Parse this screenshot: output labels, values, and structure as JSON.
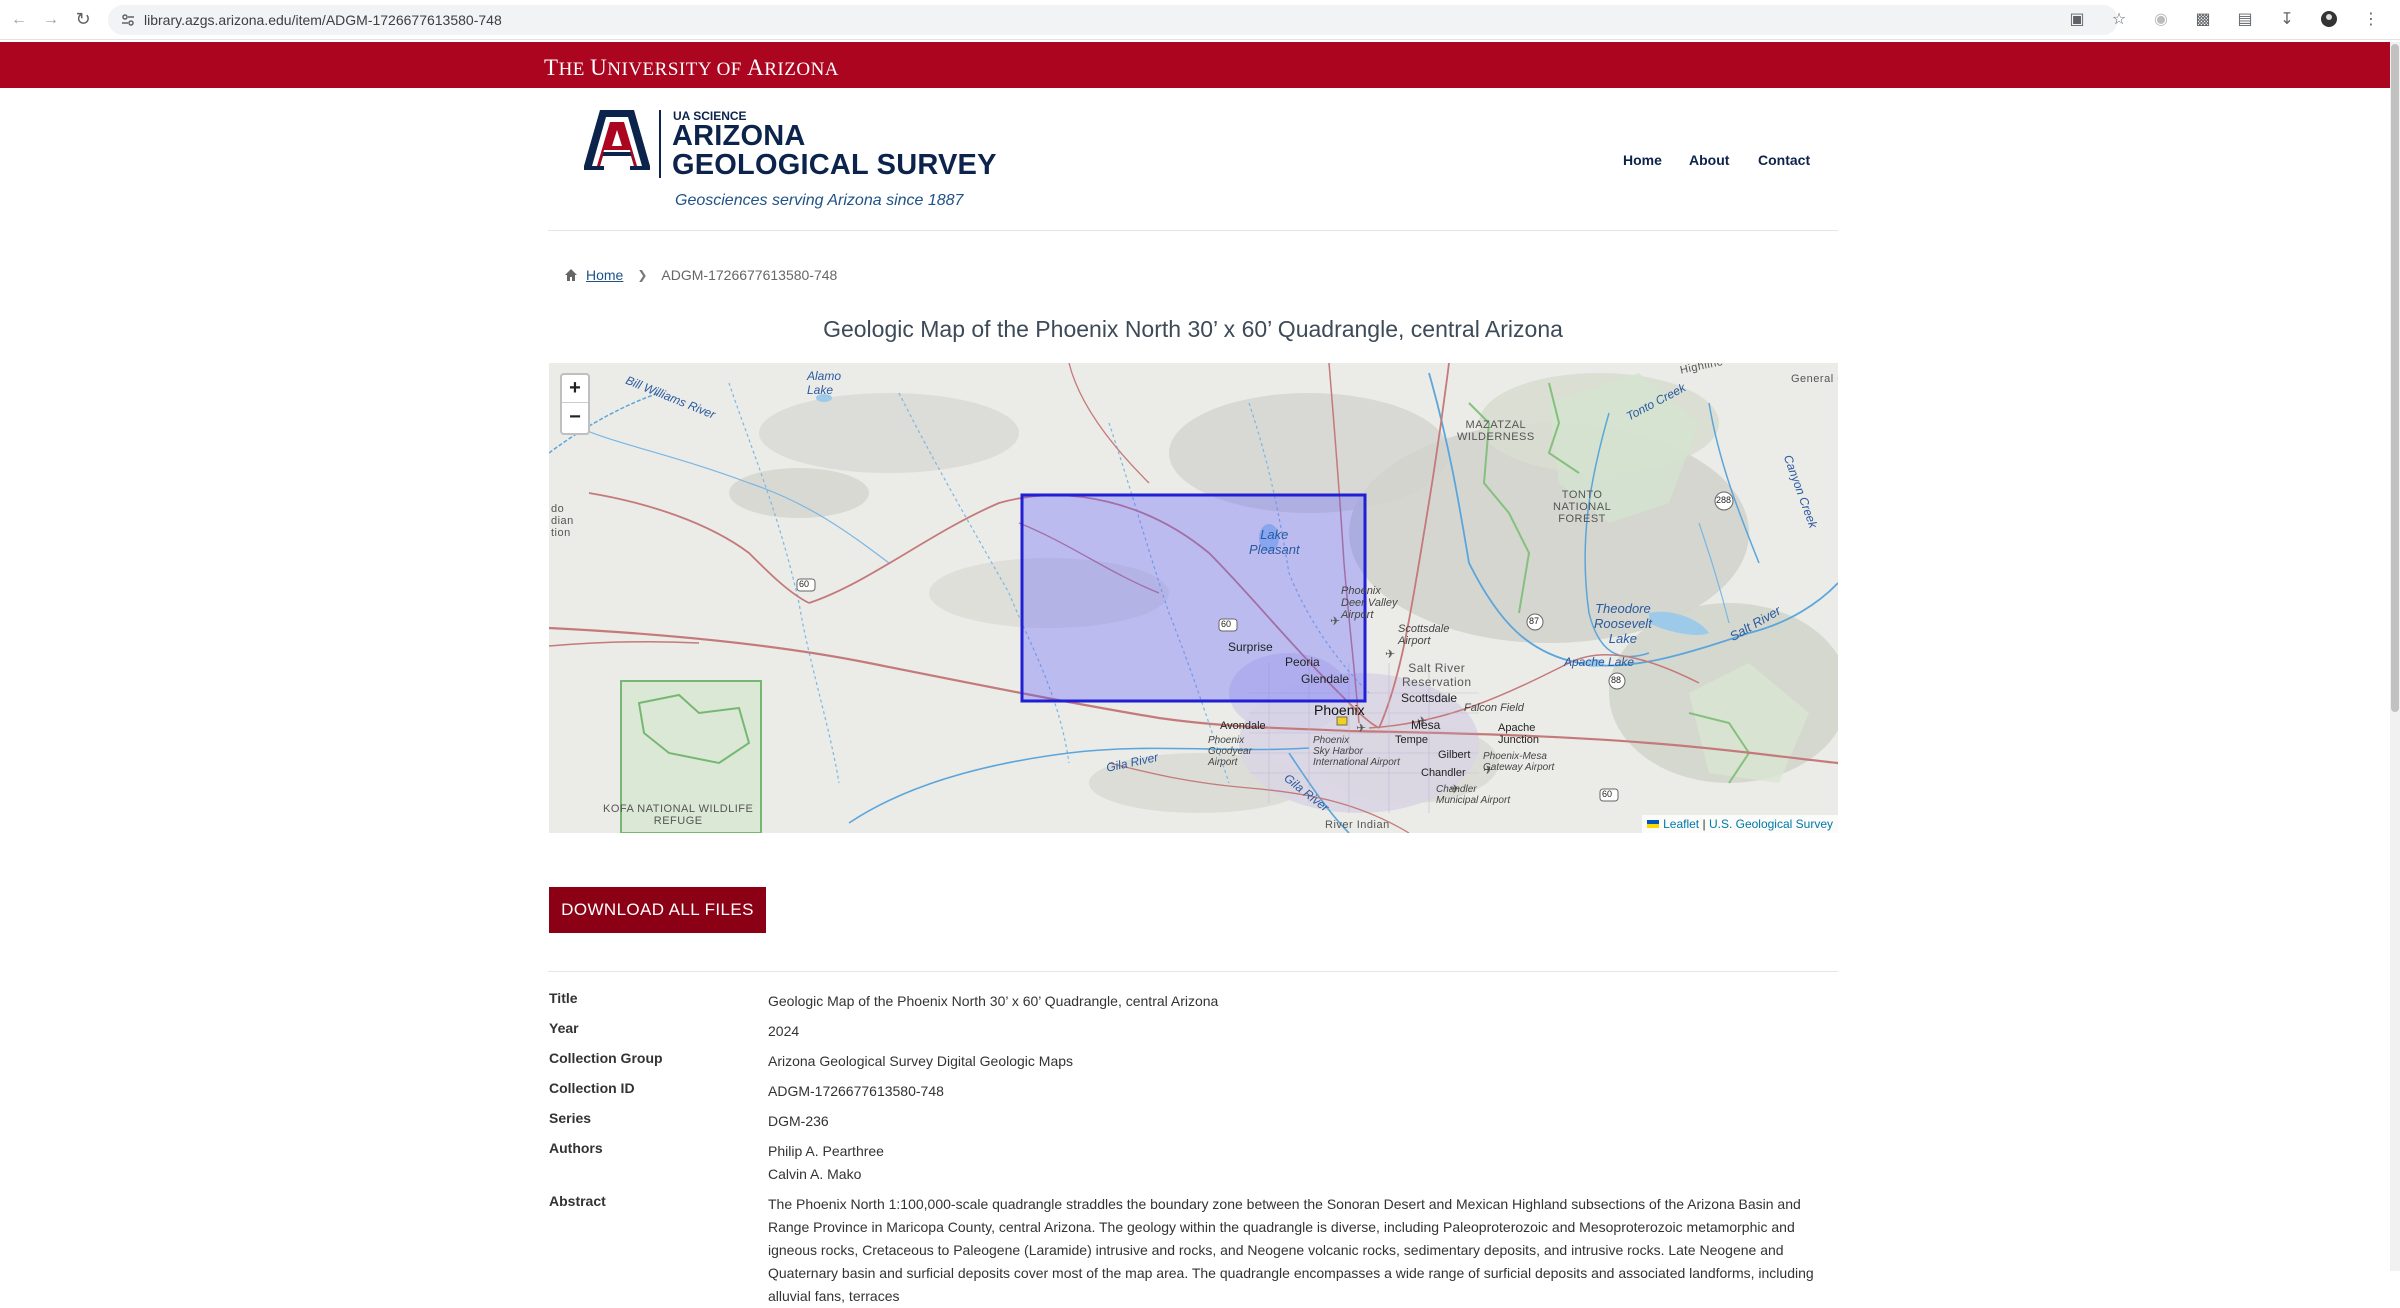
{
  "browser": {
    "url": "library.azgs.arizona.edu/item/ADGM-1726677613580-748"
  },
  "banner": {
    "university_name_prefix": "T",
    "university_name_rest": "HE ",
    "university_name_u": "U",
    "university_name_mid": "NIVERSITY OF ",
    "university_name_a": "A",
    "university_name_end": "RIZONA"
  },
  "header": {
    "ua_science": "UA SCIENCE",
    "title_line1": "ARIZONA",
    "title_line2": "GEOLOGICAL SURVEY",
    "tagline": "Geosciences serving Arizona since 1887",
    "nav": [
      {
        "label": "Home"
      },
      {
        "label": "About"
      },
      {
        "label": "Contact"
      }
    ]
  },
  "breadcrumb": {
    "home": "Home",
    "current": "ADGM-1726677613580-748"
  },
  "page_title": "Geologic Map of the Phoenix North 30’ x 60’ Quadrangle, central Arizona",
  "map": {
    "zoom_in": "+",
    "zoom_out": "−",
    "attribution_leaflet": "Leaflet",
    "attribution_sep": " | ",
    "attribution_usgs": "U.S. Geological Survey",
    "labels": {
      "bill_williams": "Bill Williams River",
      "alamo_lake_1": "Alamo",
      "alamo_lake_2": "Lake",
      "mazatzal_1": "MAZATZAL",
      "mazatzal_2": "WILDERNESS",
      "tonto_creek": "Tonto Creek",
      "tonto_nf_1": "TONTO",
      "tonto_nf_2": "NATIONAL",
      "tonto_nf_3": "FOREST",
      "lake_pleasant_1": "Lake",
      "lake_pleasant_2": "Pleasant",
      "deer_valley_1": "Phoenix",
      "deer_valley_2": "Deer Valley",
      "deer_valley_3": "Airport",
      "scottsdale_airport_1": "Scottsdale",
      "scottsdale_airport_2": "Airport",
      "salt_river_res_1": "Salt River",
      "salt_river_res_2": "Reservation",
      "theodore_1": "Theodore",
      "theodore_2": "Roosevelt",
      "theodore_3": "Lake",
      "salt_river": "Salt River",
      "apache_lake": "Apache Lake",
      "surprise": "Surprise",
      "peoria": "Peoria",
      "glendale": "Glendale",
      "phoenix": "Phoenix",
      "scottsdale": "Scottsdale",
      "falcon_field": "Falcon Field",
      "mesa": "Mesa",
      "tempe": "Tempe",
      "apache_junction_1": "Apache",
      "apache_junction_2": "Junction",
      "avondale": "Avondale",
      "goodyear_1": "Phoenix",
      "goodyear_2": "Goodyear",
      "goodyear_3": "Airport",
      "sky_harbor_1": "Phoenix",
      "sky_harbor_2": "Sky Harbor",
      "sky_harbor_3": "International Airport",
      "gilbert": "Gilbert",
      "gateway_1": "Phoenix-Mesa",
      "gateway_2": "Gateway Airport",
      "chandler": "Chandler",
      "chandler_airport_1": "Chandler",
      "chandler_airport_2": "Municipal Airport",
      "gila_river_1": "Gila River",
      "gila_river_2": "Gila River",
      "gila_river_indian": "River Indian",
      "kofa_1": "KOFA NATIONAL WILDLIFE",
      "kofa_2": "REFUGE",
      "left_edge_1": "do",
      "left_edge_2": "dian",
      "left_edge_3": "tion",
      "general_c": "General C",
      "highline": "Highline",
      "canyon_creek": "Canyon Creek",
      "route_60a": "60",
      "route_60b": "60",
      "route_60c": "60",
      "route_87": "87",
      "route_88": "88",
      "route_288": "288"
    }
  },
  "download_label": "DOWNLOAD ALL FILES",
  "metadata": [
    {
      "label": "Title",
      "value": "Geologic Map of the Phoenix North 30’ x 60’ Quadrangle, central Arizona"
    },
    {
      "label": "Year",
      "value": "2024"
    },
    {
      "label": "Collection Group",
      "value": "Arizona Geological Survey Digital Geologic Maps"
    },
    {
      "label": "Collection ID",
      "value": "ADGM-1726677613580-748"
    },
    {
      "label": "Series",
      "value": "DGM-236"
    },
    {
      "label": "Authors",
      "values": [
        "Philip A. Pearthree",
        "Calvin A. Mako"
      ]
    },
    {
      "label": "Abstract",
      "value": "The Phoenix North 1:100,000-scale quadrangle straddles the boundary zone between the Sonoran Desert and Mexican Highland subsections of the Arizona Basin and Range Province in Maricopa County, central Arizona. The geology within the quadrangle is diverse, including Paleoproterozoic and Mesoproterozoic metamorphic and igneous rocks, Cretaceous to Paleogene (Laramide) intrusive and rocks, and Neogene volcanic rocks, sedimentary deposits, and intrusive rocks. Late Neogene and Quaternary basin and surficial deposits cover most of the map area. The quadrangle encompasses a wide range of surficial deposits and associated landforms, including alluvial fans, terraces"
    }
  ]
}
